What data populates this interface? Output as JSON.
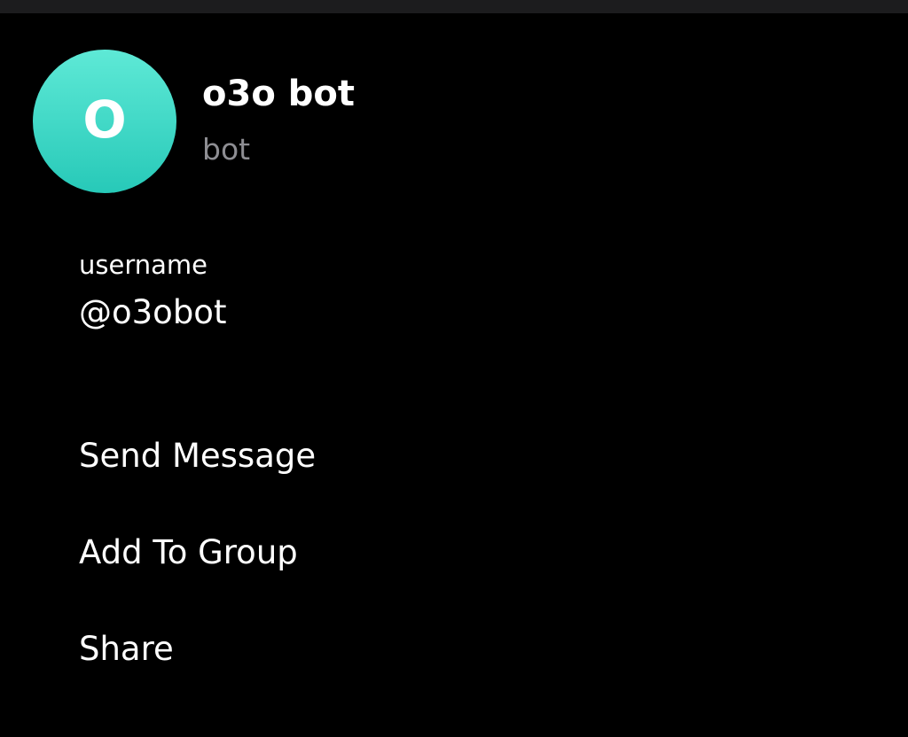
{
  "profile": {
    "avatar_letter": "O",
    "avatar_colors": [
      "#5ee9d6",
      "#27c9b8"
    ],
    "name": "o3o bot",
    "subtitle": "bot"
  },
  "info": {
    "username_label": "username",
    "username_value": "@o3obot"
  },
  "actions": [
    {
      "label": "Send Message"
    },
    {
      "label": "Add To Group"
    },
    {
      "label": "Share"
    }
  ],
  "colors": {
    "background": "#000000",
    "text_primary": "#ffffff",
    "text_secondary": "#8e8e93",
    "top_strip": "#1c1c1e"
  }
}
